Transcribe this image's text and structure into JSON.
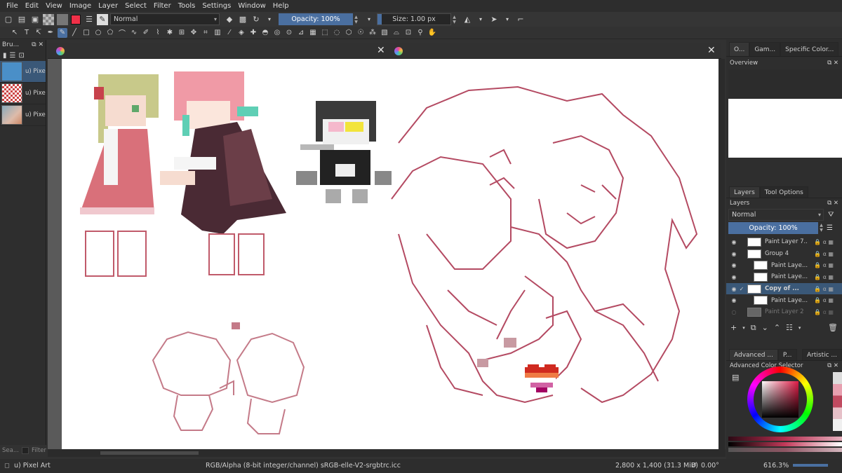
{
  "menubar": [
    "File",
    "Edit",
    "View",
    "Image",
    "Layer",
    "Select",
    "Filter",
    "Tools",
    "Settings",
    "Window",
    "Help"
  ],
  "toolbar": {
    "blend_mode": "Normal",
    "opacity_label": "Opacity: 100%",
    "size_label": "Size: 1.00 px",
    "fg_color": "#f03048",
    "accent": "#4a6fa0"
  },
  "brush_presets": {
    "title": "Bru...",
    "items": [
      "u) Pixe",
      "u) Pixe",
      "u) Pixe"
    ],
    "search_placeholder": "Sea...",
    "filter_label": "Filter"
  },
  "canvas": {
    "tabs": [
      "",
      ""
    ],
    "figures": [
      "pixel-couple",
      "pixel-character",
      "sketch-couple-large",
      "sketch-chibi-pair",
      "heart-flag"
    ]
  },
  "right_dock": {
    "top_tabs": [
      "O...",
      "Gam...",
      "Specific Color..."
    ],
    "overview_title": "Overview",
    "layer_tabs": [
      "Layers",
      "Tool Options"
    ],
    "layers_title": "Layers",
    "blend_mode": "Normal",
    "opacity_label": "Opacity:  100%",
    "layers": [
      {
        "name": "Paint Layer 7...",
        "visible": true,
        "selected": false
      },
      {
        "name": "Group 4",
        "visible": true,
        "selected": false
      },
      {
        "name": "Paint Laye...",
        "visible": true,
        "selected": false
      },
      {
        "name": "Paint Laye...",
        "visible": true,
        "selected": false
      },
      {
        "name": "Copy of ...",
        "visible": true,
        "selected": true
      },
      {
        "name": "Paint Laye...",
        "visible": true,
        "selected": false
      },
      {
        "name": "Paint Layer 2",
        "visible": false,
        "selected": false
      }
    ],
    "bottom_tabs": [
      "Advanced ...",
      "P...",
      "Artistic ..."
    ],
    "color_selector_title": "Advanced Color Selector"
  },
  "status": {
    "preset": "u) Pixel Art",
    "color_model": "RGB/Alpha (8-bit integer/channel)  sRGB-elle-V2-srgbtrc.icc",
    "image_size": "2,800 x 1,400 (31.3 MiB)",
    "rotation": "0.00°",
    "zoom": "616.3%"
  }
}
